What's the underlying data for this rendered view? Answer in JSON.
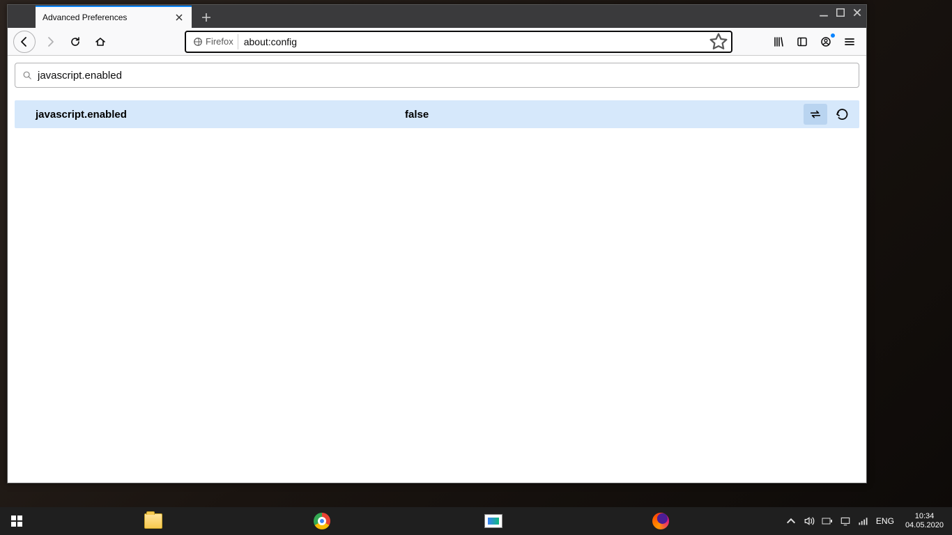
{
  "browser": {
    "tab_title": "Advanced Preferences",
    "identity_label": "Firefox",
    "url": "about:config"
  },
  "config": {
    "search_value": "javascript.enabled",
    "pref_name": "javascript.enabled",
    "pref_value": "false"
  },
  "taskbar": {
    "language": "ENG",
    "time": "10:34",
    "date": "04.05.2020"
  }
}
